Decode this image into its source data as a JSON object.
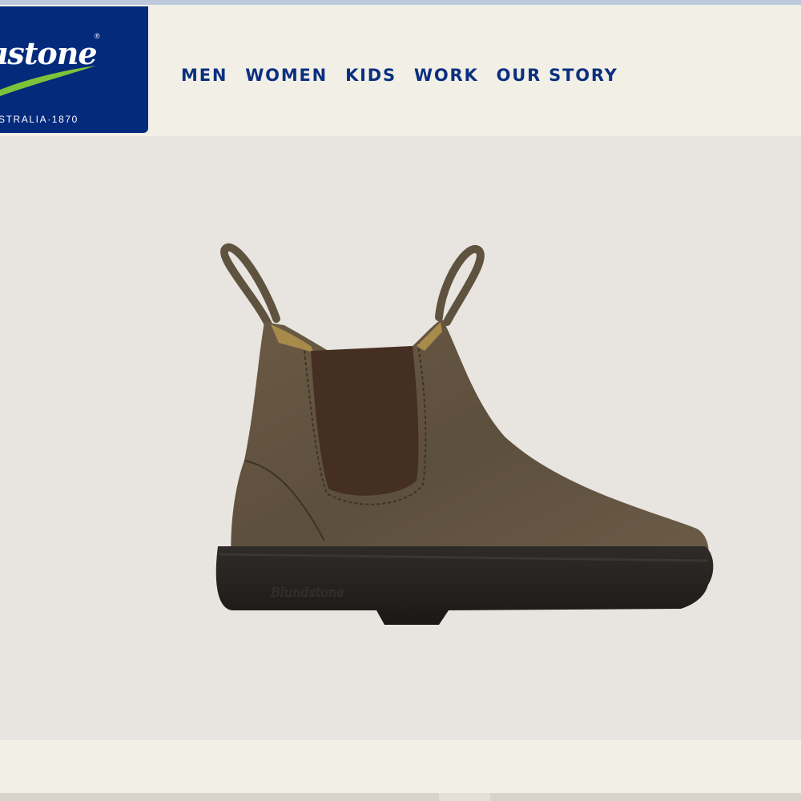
{
  "brand": {
    "wordmark": "ıstone",
    "registered": "®",
    "tagline": "STRALIA·1870",
    "logo_bg": "#042a7c",
    "accent": "#7ec23a"
  },
  "nav": {
    "items": [
      {
        "label": "MEN"
      },
      {
        "label": "WOMEN"
      },
      {
        "label": "KIDS"
      },
      {
        "label": "WORK"
      },
      {
        "label": "OUR STORY"
      }
    ],
    "color": "#0b2f80"
  },
  "product": {
    "image": "brown leather chelsea boot",
    "sole_emboss": "Blundstone"
  }
}
